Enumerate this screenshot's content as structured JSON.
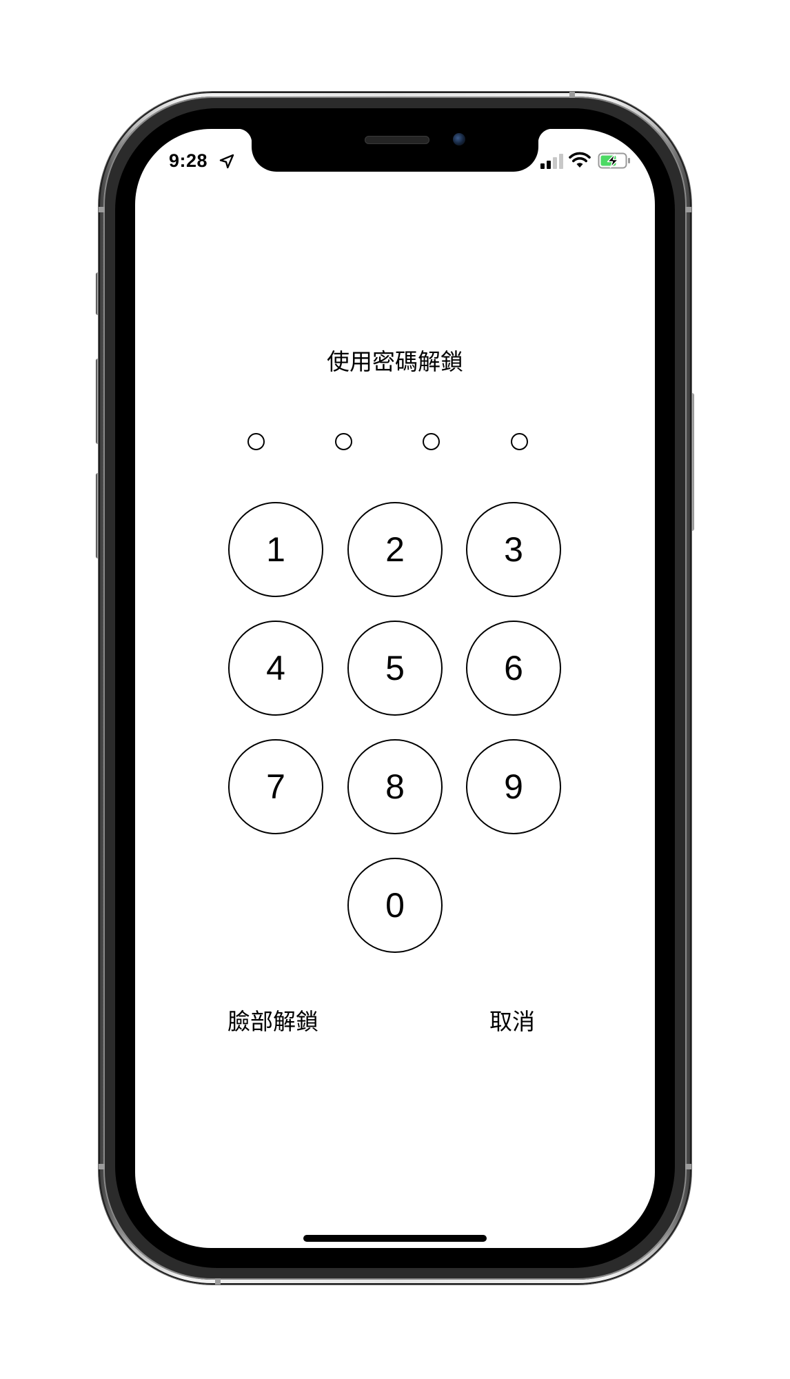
{
  "status_bar": {
    "time": "9:28",
    "location_icon": "location-arrow-icon",
    "signal_icon": "cellular-signal-icon",
    "wifi_icon": "wifi-icon",
    "battery_icon": "battery-charging-icon",
    "battery_color": "#4cd964"
  },
  "passcode": {
    "prompt": "使用密碼解鎖",
    "dot_count": 4,
    "keys": [
      "1",
      "2",
      "3",
      "4",
      "5",
      "6",
      "7",
      "8",
      "9",
      "0"
    ]
  },
  "actions": {
    "face_unlock": "臉部解鎖",
    "cancel": "取消"
  },
  "colors": {
    "text": "#000000",
    "background": "#ffffff"
  }
}
